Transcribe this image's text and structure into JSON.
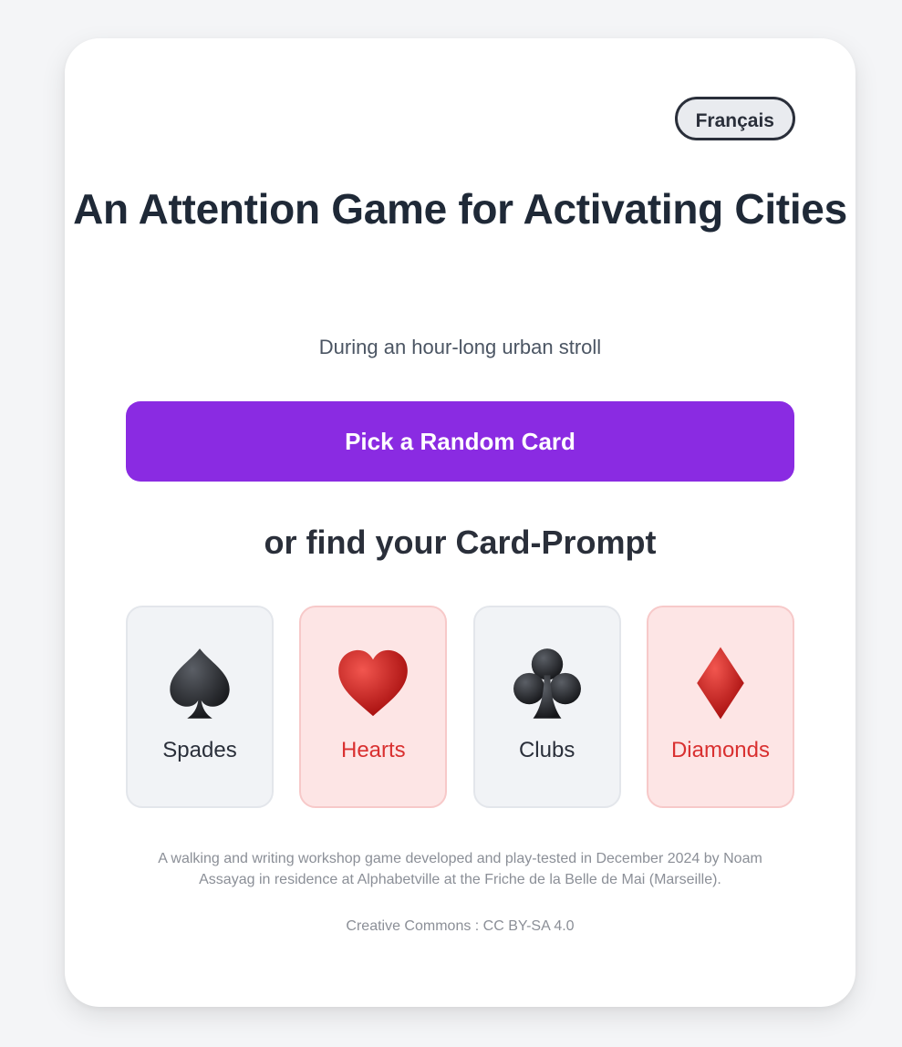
{
  "language_button": {
    "label": "Français"
  },
  "title": "An Attention Game for Activating Cities",
  "subtitle": "During an hour-long urban stroll",
  "pick_button": {
    "label": "Pick a Random Card"
  },
  "find_heading": "or find your Card-Prompt",
  "suits": [
    {
      "name": "Spades",
      "icon": "spade-icon",
      "color": "#2a2f3a"
    },
    {
      "name": "Hearts",
      "icon": "heart-icon",
      "color": "#d93030"
    },
    {
      "name": "Clubs",
      "icon": "club-icon",
      "color": "#2a2f3a"
    },
    {
      "name": "Diamonds",
      "icon": "diamond-icon",
      "color": "#d93030"
    }
  ],
  "footer": {
    "description": "A walking and writing workshop game developed and play-tested in December 2024 by Noam Assayag in residence at Alphabetville at the Friche de la Belle de Mai (Marseille).",
    "license": "Creative Commons : CC BY-SA 4.0"
  },
  "colors": {
    "accent": "#8a2be2",
    "page_background": "#f4f5f7",
    "card_background": "#ffffff",
    "red_suit": "#d93030",
    "red_suit_background": "#fde5e5",
    "black_suit_background": "#f1f3f6"
  }
}
